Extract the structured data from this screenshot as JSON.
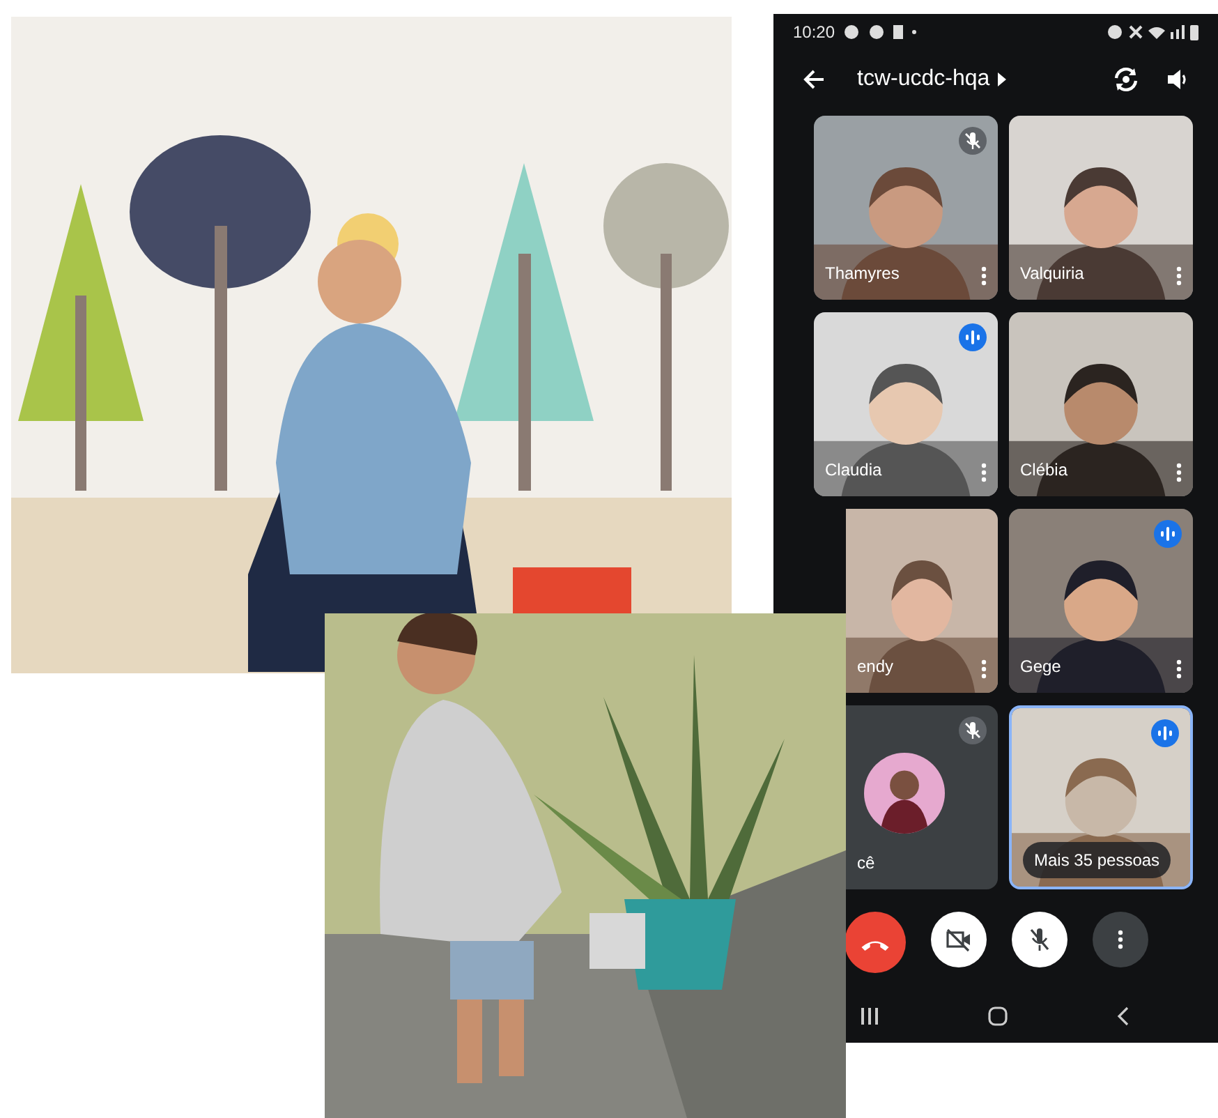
{
  "phone": {
    "status_bar": {
      "time": "10:20"
    },
    "toolbar": {
      "title": "tcw-ucdc-hqa"
    },
    "tiles": [
      {
        "kind": "video",
        "name": "Thamyres",
        "muted": true,
        "speaking": false,
        "highlighted": false
      },
      {
        "kind": "video",
        "name": "Valquiria",
        "muted": false,
        "speaking": false,
        "highlighted": false
      },
      {
        "kind": "video",
        "name": "Claudia",
        "muted": false,
        "speaking": true,
        "highlighted": false
      },
      {
        "kind": "video",
        "name": "Clébia",
        "muted": false,
        "speaking": false,
        "highlighted": false
      },
      {
        "kind": "video",
        "name": "endy",
        "muted": false,
        "speaking": false,
        "highlighted": false
      },
      {
        "kind": "video",
        "name": "Gege",
        "muted": false,
        "speaking": true,
        "highlighted": false
      },
      {
        "kind": "self",
        "name": "cê",
        "muted": true,
        "speaking": false,
        "highlighted": false
      },
      {
        "kind": "overflow",
        "label": "Mais 35 pessoas",
        "muted": false,
        "speaking": true,
        "highlighted": true
      }
    ],
    "controls": [
      {
        "kind": "end_call"
      },
      {
        "kind": "camera",
        "on": false
      },
      {
        "kind": "microphone",
        "on": false
      },
      {
        "kind": "more"
      }
    ]
  }
}
